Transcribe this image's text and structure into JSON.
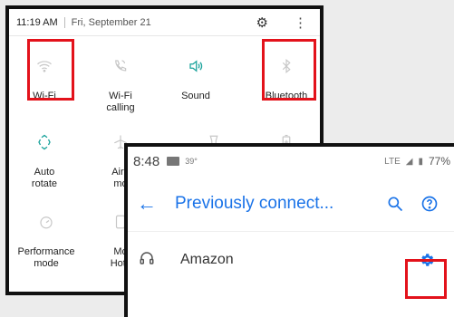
{
  "quick_settings": {
    "status": {
      "time": "11:19 AM",
      "date": "Fri, September 21"
    },
    "tiles": [
      {
        "label": "Wi-Fi",
        "icon": "wifi-icon"
      },
      {
        "label": "Wi-Fi\ncalling",
        "icon": "wifi-calling-icon"
      },
      {
        "label": "Sound",
        "icon": "sound-icon"
      },
      {
        "label": "Bluetooth",
        "icon": "bluetooth-icon"
      },
      {
        "label": "Auto\nrotate",
        "icon": "auto-rotate-icon"
      },
      {
        "label": "Airp\nmo",
        "icon": "airplane-icon"
      },
      {
        "label": "",
        "icon": "flashlight-icon"
      },
      {
        "label": "",
        "icon": "power-saving-icon"
      },
      {
        "label": "Performance\nmode",
        "icon": "performance-icon"
      },
      {
        "label": "Mo\nHots",
        "icon": "mobile-hotspot-icon"
      }
    ],
    "highlight_color": "#e3121b"
  },
  "bluetooth_screen": {
    "status": {
      "time": "8:48",
      "temp": "39°",
      "network": "LTE",
      "battery": "77%"
    },
    "title": "Previously connect...",
    "accent": "#1a73e8",
    "device": {
      "name": "Amazon"
    }
  }
}
